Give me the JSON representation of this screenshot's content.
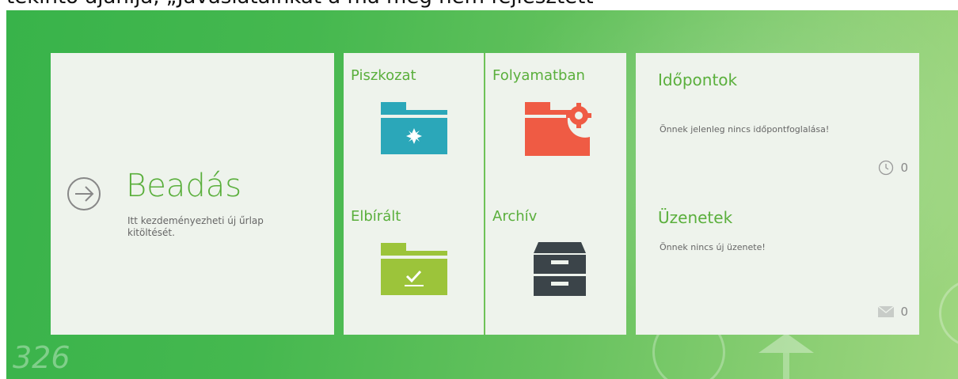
{
  "heading": {
    "text": "tekintő ajánlja, „Javaslatainkat a ma még nem fejlesztett"
  },
  "background": {
    "deco_number": "326"
  },
  "submit_tile": {
    "title": "Beadás",
    "description": "Itt kezdeményezheti új űrlap kitöltését.",
    "icon": "arrow-right-circle-icon"
  },
  "folders": [
    {
      "label": "Piszkozat",
      "icon": "draft-folder-icon",
      "color": "#2ba7b9"
    },
    {
      "label": "Folyamatban",
      "icon": "in-progress-folder-icon",
      "color": "#ef5b44"
    },
    {
      "label": "Elbírált",
      "icon": "reviewed-folder-icon",
      "color": "#9cc43a"
    },
    {
      "label": "Archív",
      "icon": "archive-cabinet-icon",
      "color": "#3b4449"
    }
  ],
  "appointments": {
    "title": "Időpontok",
    "message": "Önnek jelenleg nincs időpontfoglalása!",
    "count": "0",
    "icon": "clock-icon"
  },
  "messages": {
    "title": "Üzenetek",
    "message": "Önnek nincs új üzenete!",
    "count": "0",
    "icon": "envelope-icon"
  },
  "colors": {
    "accent": "#5aaf3c",
    "tile_bg": "#eef3ec"
  }
}
